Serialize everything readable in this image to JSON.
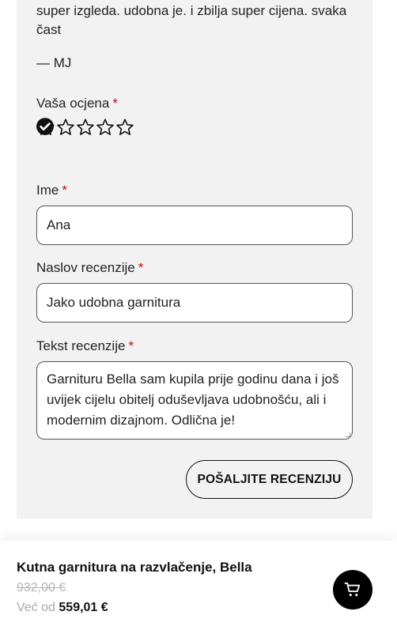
{
  "review": {
    "text": "super izgleda. udobna je. i zbilja super cijena. svaka čast",
    "author": "— MJ"
  },
  "form": {
    "rating_label": "Vaša ocjena",
    "required_mark": "*",
    "rating": {
      "max": 5,
      "hovered": 1
    },
    "name_label": "Ime",
    "name_value": "Ana",
    "title_label": "Naslov recenzije",
    "title_value": "Jako udobna garnitura",
    "text_label": "Tekst recenzije",
    "text_value": "Garnituru Bella sam kupila prije godinu dana i još uvijek cijelu obitelj oduševljava udobnošću, ali i modernim dizajnom. Odlična je!",
    "submit_label": "POŠALJITE RECENZIJU"
  },
  "product_bar": {
    "name": "Kutna garnitura na razvlačenje, Bella",
    "old_price": "932,00 €",
    "price_prefix": "Već od",
    "price": "559,01 €",
    "cart_icon": "cart-icon"
  }
}
